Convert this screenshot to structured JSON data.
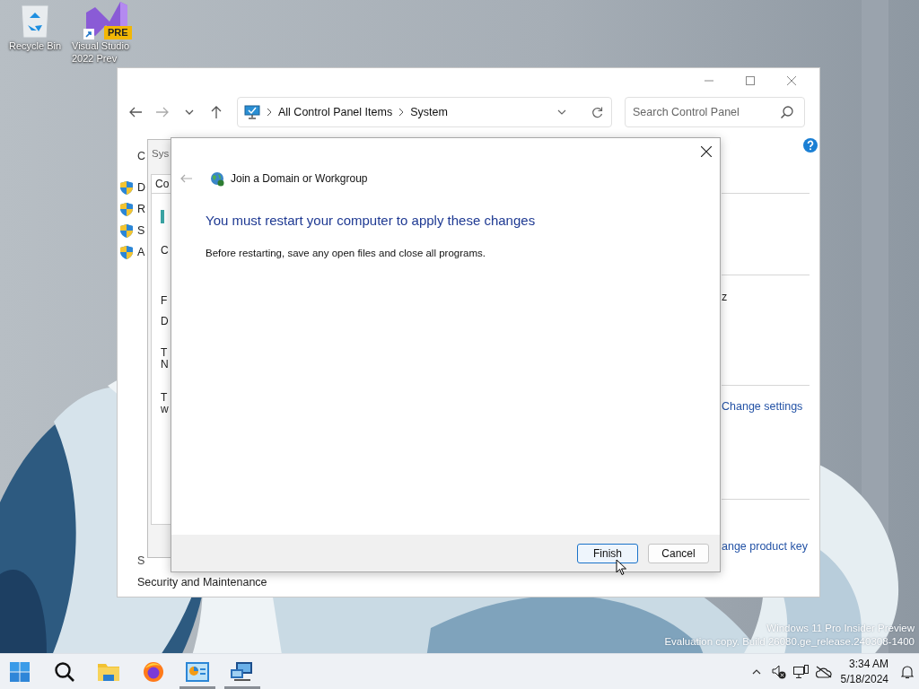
{
  "desktop_icons": [
    {
      "kind": "recycle-bin",
      "label_lines": [
        "Recycle Bin"
      ]
    },
    {
      "kind": "visual-studio",
      "label_lines": [
        "Visual Studio",
        "2022 Prev"
      ],
      "badge": "PRE"
    }
  ],
  "control_panel": {
    "address": [
      "All Control Panel Items",
      "System"
    ],
    "search": {
      "placeholder": "Search Control Panel"
    },
    "left_pane": {
      "heading": "C",
      "tasks": [
        "D",
        "R",
        "S",
        "A"
      ],
      "see_also": "S",
      "link": "Security and Maintenance"
    },
    "right_pane": {
      "text": "z",
      "links": [
        "Change settings",
        "ange product key"
      ]
    }
  },
  "system_properties": {
    "title": "Sys",
    "tab": "Co",
    "paragraphs": [
      {
        "lines": [
          "C"
        ]
      },
      {
        "lines": [
          "F"
        ]
      },
      {
        "lines": [
          "D"
        ]
      },
      {
        "lines": [
          "T",
          "N"
        ]
      },
      {
        "lines": [
          "T",
          "w"
        ]
      }
    ]
  },
  "dialog": {
    "title": "Join a Domain or Workgroup",
    "heading": "You must restart your computer to apply these changes",
    "body": "Before restarting, save any open files and close all programs.",
    "buttons": [
      {
        "label": "Finish",
        "default": true
      },
      {
        "label": "Cancel",
        "default": false
      }
    ]
  },
  "watermark": [
    "Windows 11 Pro Insider Preview",
    "Evaluation copy. Build 26080.ge_release.240308-1400"
  ],
  "taskbar": {
    "apps": [
      {
        "kind": "start",
        "running": false
      },
      {
        "kind": "search",
        "running": false
      },
      {
        "kind": "explorer",
        "running": false
      },
      {
        "kind": "firefox",
        "running": false
      },
      {
        "kind": "control-panel",
        "running": true
      },
      {
        "kind": "remote-desktop",
        "running": true
      }
    ],
    "time": "3:34 AM",
    "date": "5/18/2024"
  }
}
